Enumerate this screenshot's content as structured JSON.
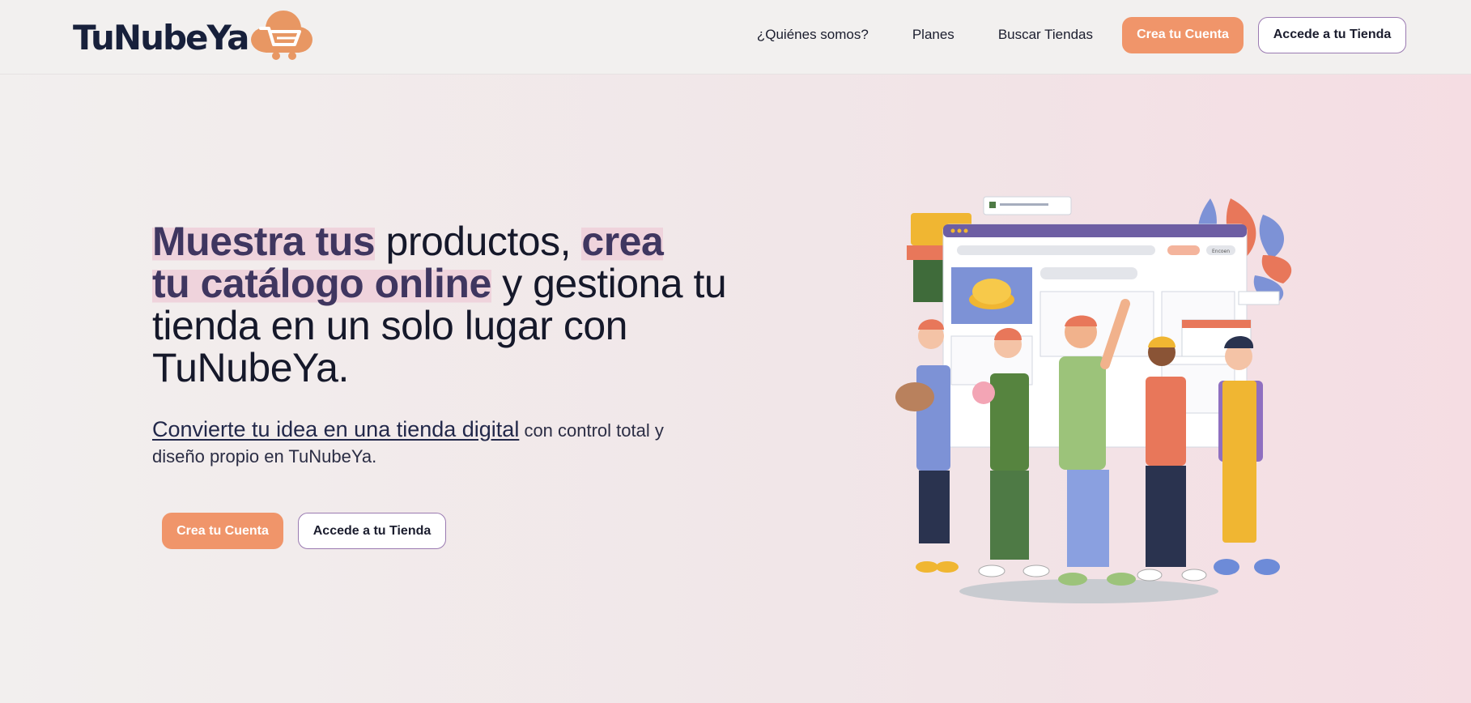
{
  "brand": {
    "name": "TuNubeYa",
    "colors": {
      "orange": "#f0956a",
      "navy": "#17203b",
      "purple": "#3f3660"
    }
  },
  "nav": {
    "links": [
      "¿Quiénes somos?",
      "Planes",
      "Buscar Tiendas"
    ],
    "cta_primary": "Crea tu Cuenta",
    "cta_secondary": "Accede a tu Tienda"
  },
  "hero": {
    "title_hl1": "Muestra tus",
    "title_part1": " productos, ",
    "title_hl2": "crea",
    "title_hl3": "tu catálogo online",
    "title_part2": " y gestiona tu tienda en un solo lugar con TuNubeYa.",
    "sub_link": "Convierte tu idea en una tienda digital",
    "sub_text": " con control total y diseño propio en TuNubeYa.",
    "cta_primary": "Crea tu Cuenta",
    "cta_secondary": "Accede a tu Tienda"
  },
  "illustration": {
    "name": "team-of-shop-owners-illustration",
    "mockup_search_placeholder": "Encoen"
  }
}
